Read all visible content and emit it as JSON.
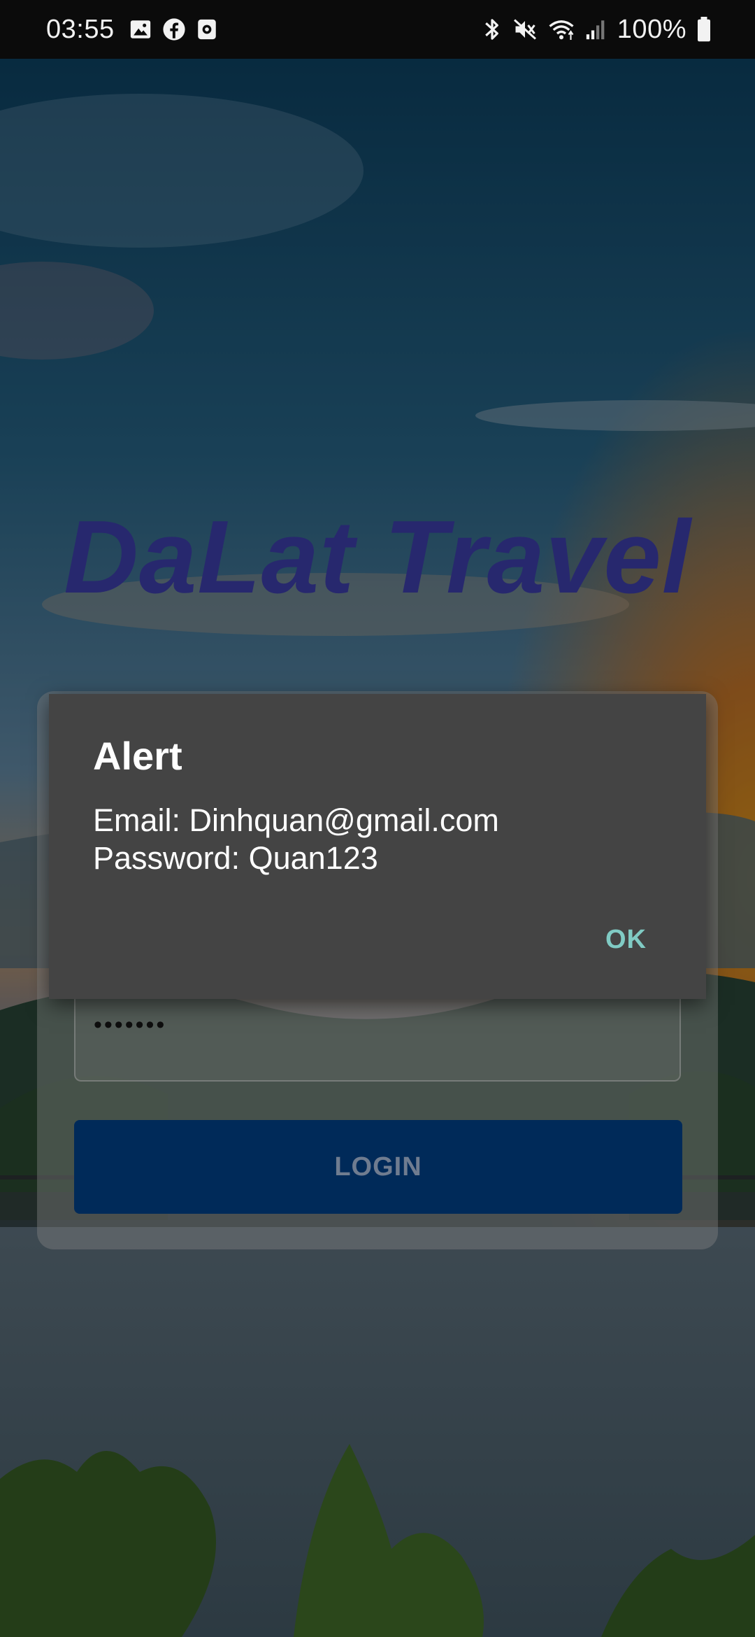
{
  "status_bar": {
    "time": "03:55",
    "battery": "100%",
    "icons": [
      "gallery-icon",
      "facebook-icon",
      "screen-record-icon",
      "bluetooth-icon",
      "mute-icon",
      "wifi-icon",
      "signal-icon",
      "battery-icon"
    ]
  },
  "app": {
    "title": "DaLat Travel",
    "title_color": "#27286e"
  },
  "login_form": {
    "password_value": "•••••••",
    "login_label": "LOGIN",
    "login_button_color": "#002a59"
  },
  "alert": {
    "title": "Alert",
    "message_line1": "Email: Dinhquan@gmail.com",
    "message_line2": "Password: Quan123",
    "ok_label": "OK",
    "accent_color": "#80cbc4"
  }
}
